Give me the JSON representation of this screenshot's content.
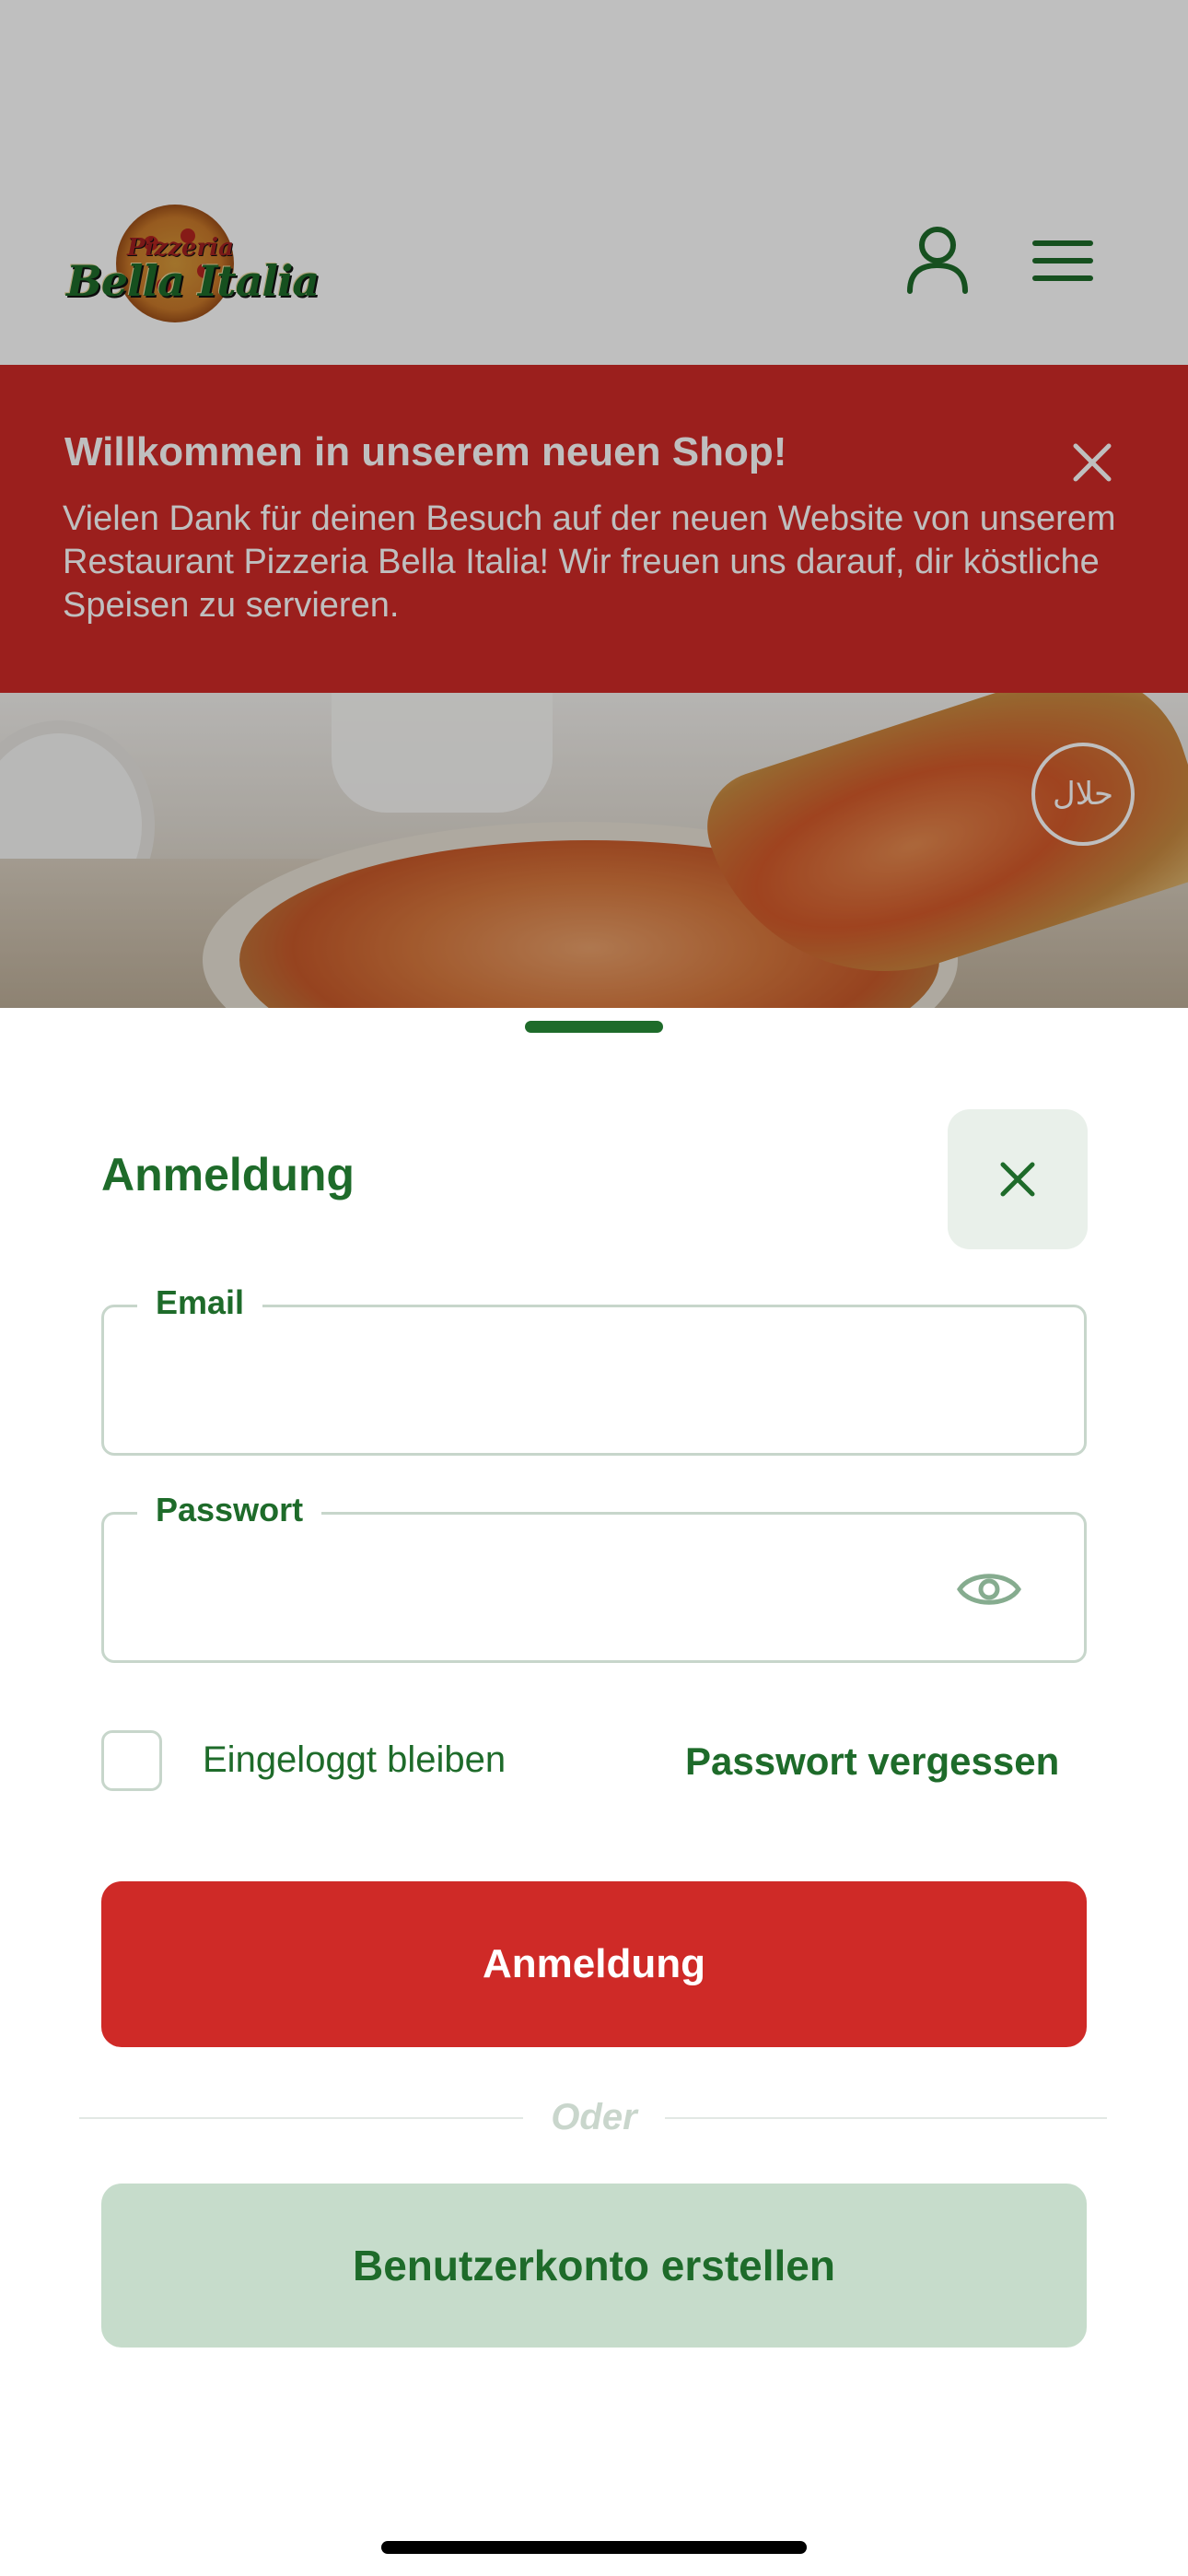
{
  "header": {
    "logo_text": "Bella Italia",
    "logo_small_text": "Pizzeria",
    "account_icon": "user-icon",
    "menu_icon": "hamburger-menu-icon"
  },
  "banner": {
    "title": "Willkommen in unserem neuen Shop!",
    "text": "Vielen Dank für deinen Besuch auf der neuen Website von unserem Restaurant Pizzeria Bella Italia! Wir freuen uns darauf, dir köstliche Speisen zu servieren.",
    "close_icon": "close-icon",
    "color": "#cf2a27"
  },
  "hero": {
    "badge_text": "حلال"
  },
  "login": {
    "title": "Anmeldung",
    "close_icon": "close-icon",
    "email_label": "Email",
    "email_value": "",
    "password_label": "Passwort",
    "password_value": "",
    "password_toggle_icon": "eye-icon",
    "remember_label": "Eingeloggt bleiben",
    "remember_checked": false,
    "forgot_label": "Passwort vergessen",
    "submit_label": "Anmeldung",
    "divider_label": "Oder",
    "register_label": "Benutzerkonto erstellen"
  },
  "colors": {
    "brand_green": "#1e6b2a",
    "primary_red": "#cf2a27",
    "secondary_green_bg": "#c6dccb"
  }
}
